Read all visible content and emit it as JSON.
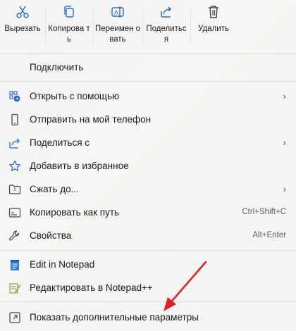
{
  "toolbar": {
    "cut": "Вырезать",
    "copy": "Копирова ть",
    "rename": "Переимен овать",
    "share": "Поделитьс я",
    "delete": "Удалить"
  },
  "items": {
    "connect": "Подключить",
    "open_with": "Открыть с помощью",
    "send_phone": "Отправить на мой телефон",
    "share_with": "Поделиться с",
    "add_favorites": "Добавить в избранное",
    "compress": "Сжать до...",
    "copy_path": "Копировать как путь",
    "copy_path_shortcut": "Ctrl+Shift+C",
    "properties": "Свойства",
    "properties_shortcut": "Alt+Enter",
    "edit_notepad": "Edit in Notepad",
    "edit_notepadpp": "Редактировать в Notepad++",
    "more_options": "Показать дополнительные параметры"
  },
  "colors": {
    "accent": "#2b6cc4",
    "arrow": "#e02020"
  }
}
